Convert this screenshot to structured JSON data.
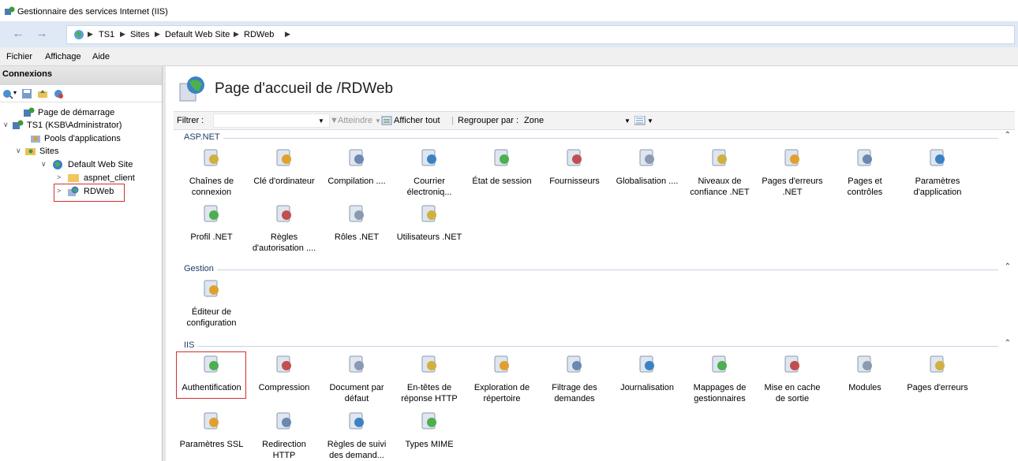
{
  "window": {
    "title": "Gestionnaire des services Internet (IIS)"
  },
  "address": {
    "crumbs": [
      "TS1",
      "Sites",
      "Default Web Site",
      "RDWeb"
    ]
  },
  "menu": [
    "Fichier",
    "Affichage",
    "Aide"
  ],
  "connections": {
    "header": "Connexions",
    "tree": {
      "start": "Page de démarrage",
      "server": "TS1 (KSB\\Administrator)",
      "pools": "Pools d'applications",
      "sites": "Sites",
      "default_site": "Default Web Site",
      "aspnet": "aspnet_client",
      "rdweb": "RDWeb"
    }
  },
  "main": {
    "title": "Page d'accueil de /RDWeb",
    "filter": {
      "label": "Filtrer :",
      "goto": "Atteindre",
      "show_all": "Afficher tout",
      "group_by_label": "Regrouper par :",
      "group_by_value": "Zone"
    },
    "groups": {
      "aspnet": {
        "title": "ASP.NET",
        "items": [
          {
            "label": "Chaînes de\nconnexion",
            "icon": "connection-strings-icon"
          },
          {
            "label": "Clé d'ordinateur",
            "icon": "machine-key-icon"
          },
          {
            "label": "Compilation ....",
            "icon": "compilation-icon"
          },
          {
            "label": "Courrier\nélectroniq...",
            "icon": "smtp-email-icon"
          },
          {
            "label": "État de session",
            "icon": "session-state-icon"
          },
          {
            "label": "Fournisseurs",
            "icon": "providers-icon"
          },
          {
            "label": "Globalisation ....",
            "icon": "globalization-icon"
          },
          {
            "label": "Niveaux de\nconfiance .NET",
            "icon": "trust-levels-icon"
          },
          {
            "label": "Pages d'erreurs\n.NET",
            "icon": "error-pages-net-icon"
          },
          {
            "label": "Pages et\ncontrôles",
            "icon": "pages-controls-icon"
          },
          {
            "label": "Paramètres\nd'application",
            "icon": "app-settings-icon"
          },
          {
            "label": "Profil .NET",
            "icon": "net-profile-icon"
          },
          {
            "label": "Règles\nd'autorisation ....",
            "icon": "authorization-rules-icon"
          },
          {
            "label": "Rôles .NET",
            "icon": "net-roles-icon"
          },
          {
            "label": "Utilisateurs .NET",
            "icon": "net-users-icon"
          }
        ]
      },
      "gestion": {
        "title": "Gestion",
        "items": [
          {
            "label": "Éditeur de\nconfiguration",
            "icon": "config-editor-icon"
          }
        ]
      },
      "iis": {
        "title": "IIS",
        "items": [
          {
            "label": "Authentification",
            "icon": "authentication-icon"
          },
          {
            "label": "Compression",
            "icon": "compression-icon"
          },
          {
            "label": "Document par\ndéfaut",
            "icon": "default-document-icon"
          },
          {
            "label": "En-têtes de\nréponse HTTP",
            "icon": "http-headers-icon"
          },
          {
            "label": "Exploration de\nrépertoire",
            "icon": "directory-browsing-icon"
          },
          {
            "label": "Filtrage des\ndemandes",
            "icon": "request-filtering-icon"
          },
          {
            "label": "Journalisation",
            "icon": "logging-icon"
          },
          {
            "label": "Mappages de\ngestionnaires",
            "icon": "handler-mappings-icon"
          },
          {
            "label": "Mise en cache\nde sortie",
            "icon": "output-caching-icon"
          },
          {
            "label": "Modules",
            "icon": "modules-icon"
          },
          {
            "label": "Pages d'erreurs",
            "icon": "error-pages-icon"
          },
          {
            "label": "Paramètres SSL",
            "icon": "ssl-settings-icon"
          },
          {
            "label": "Redirection\nHTTP",
            "icon": "http-redirect-icon"
          },
          {
            "label": "Règles de suivi\ndes demand...",
            "icon": "failed-request-tracing-icon"
          },
          {
            "label": "Types MIME",
            "icon": "mime-types-icon"
          }
        ]
      }
    }
  }
}
